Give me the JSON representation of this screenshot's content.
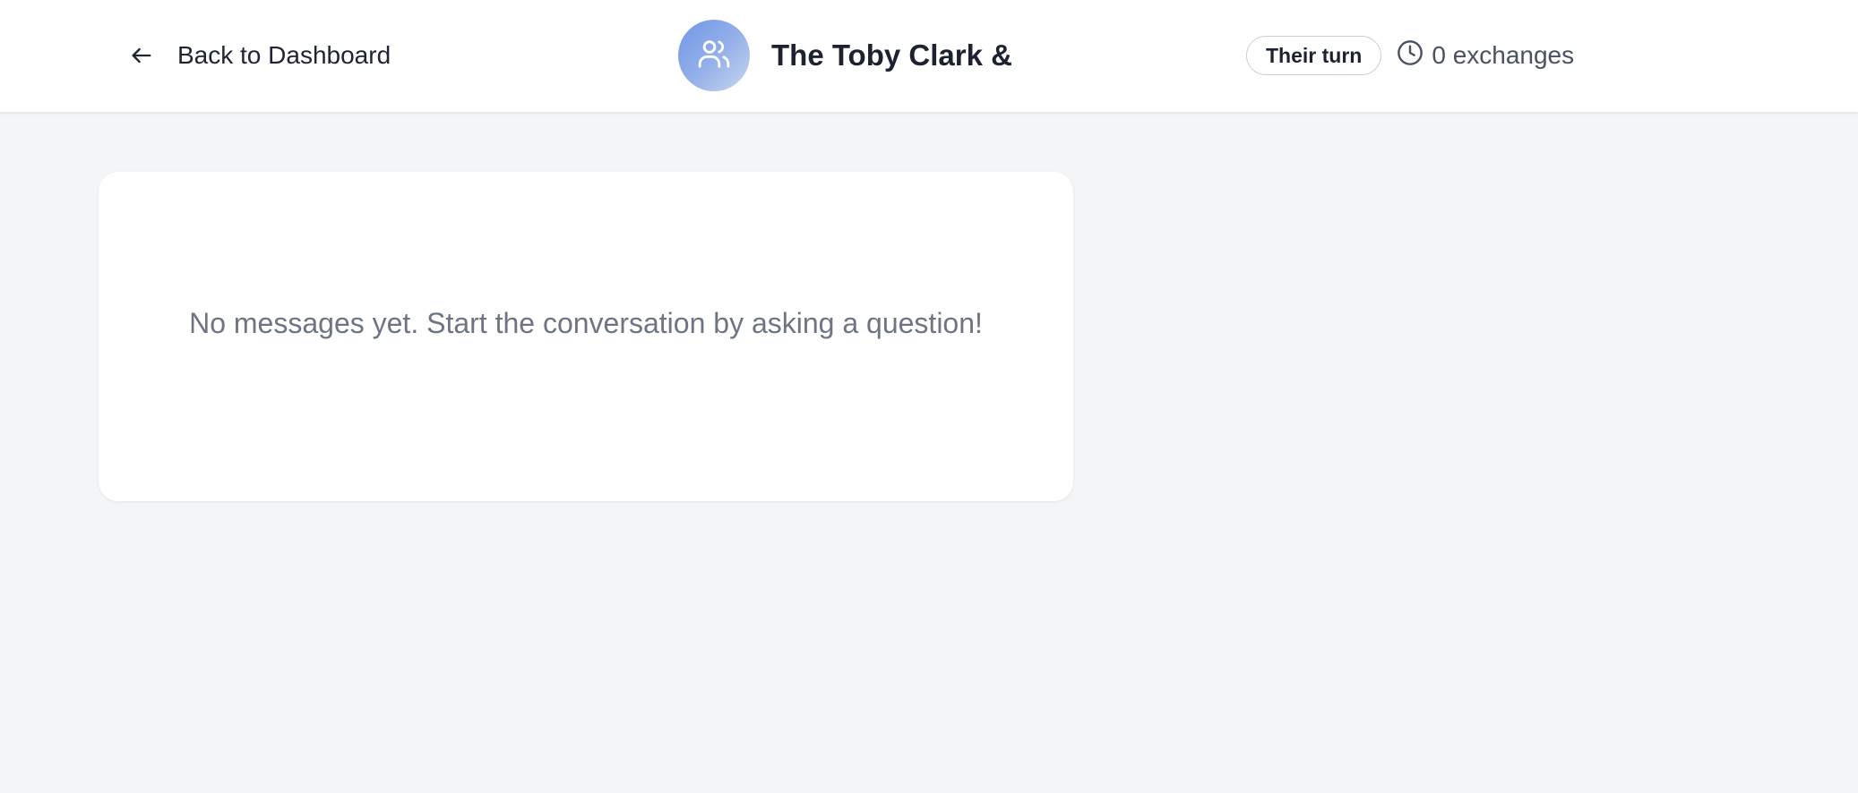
{
  "header": {
    "back_label": "Back to Dashboard",
    "back_icon": "arrow-left-icon",
    "avatar_icon": "users-icon",
    "title": "The Toby Clark &",
    "turn_badge": "Their turn",
    "exchanges_icon": "clock-icon",
    "exchanges_label": "0 exchanges"
  },
  "messages": {
    "empty_text": "No messages yet. Start the conversation by asking a question!"
  },
  "colors": {
    "page_background": "#f4f5f7",
    "avatar_gradient_start": "#6f95e6",
    "avatar_gradient_end": "#c9d6ef",
    "text_primary": "#1c2230",
    "text_muted": "#6d7585"
  }
}
